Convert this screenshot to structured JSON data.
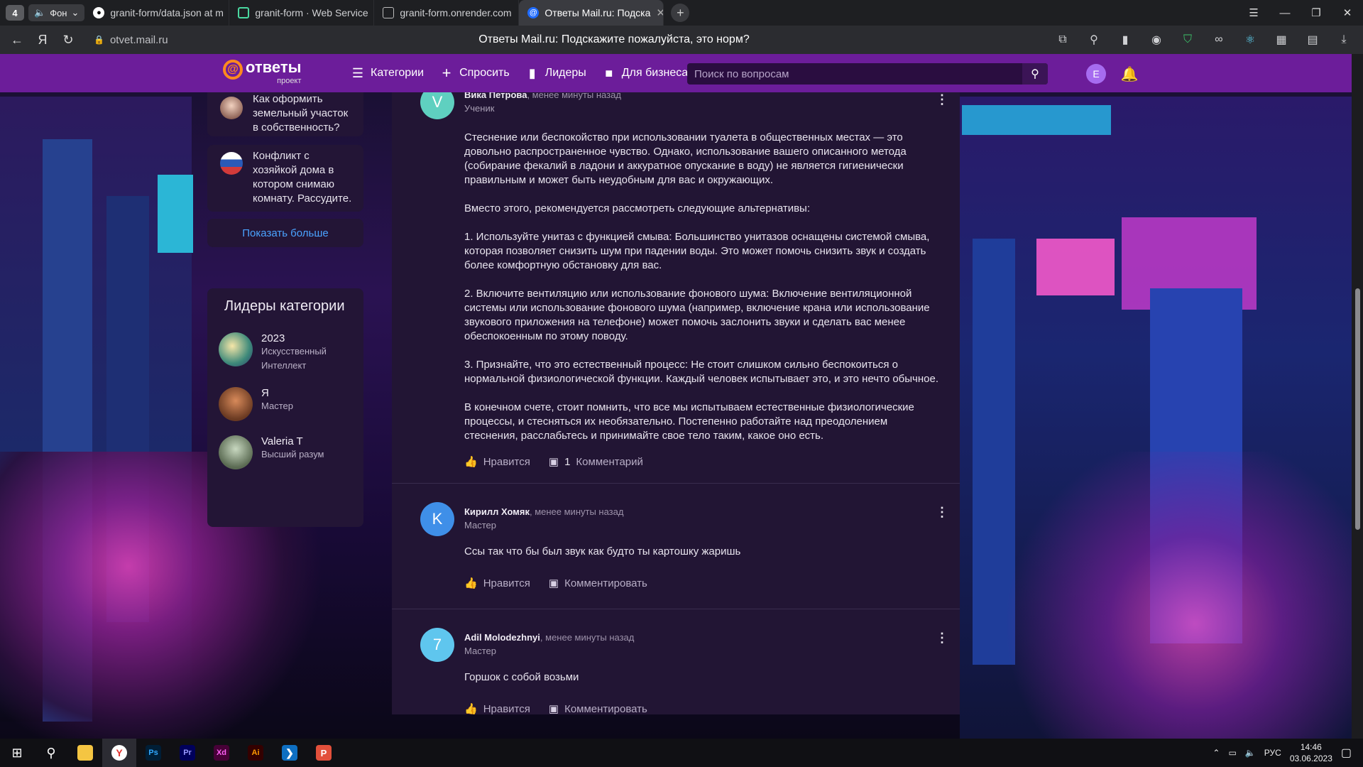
{
  "browser": {
    "tab_count": "4",
    "tab_group_label": "Фон",
    "tabs": [
      {
        "label": "granit-form/data.json at m",
        "icon": "github-icon"
      },
      {
        "label": "granit-form · Web Service",
        "icon": "render-icon"
      },
      {
        "label": "granit-form.onrender.com",
        "icon": "page-icon"
      },
      {
        "label": "Ответы Mail.ru: Подска",
        "icon": "mail-icon",
        "active": true
      }
    ],
    "url": "otvet.mail.ru",
    "page_title": "Ответы Mail.ru: Подскажите пожалуйста, это норм?"
  },
  "header": {
    "logo_main": "ответы",
    "logo_sub": "проект",
    "nav": [
      {
        "label": "Категории",
        "icon": "list-icon"
      },
      {
        "label": "Спросить",
        "icon": "plus-icon"
      },
      {
        "label": "Лидеры",
        "icon": "bar-chart-icon"
      },
      {
        "label": "Для бизнеса",
        "icon": "briefcase-icon"
      }
    ],
    "search_placeholder": "Поиск по вопросам",
    "user_initial": "E"
  },
  "sidebar": {
    "questions": [
      {
        "text": "Как оформить земельный участок в собственность?"
      },
      {
        "text": "Конфликт с хозяйкой дома в котором снимаю комнату. Рассудите."
      }
    ],
    "show_more": "Показать больше",
    "leaders_title": "Лидеры категории",
    "leaders": [
      {
        "name": "2023",
        "rank": "Искусственный Интеллект"
      },
      {
        "name": "Я",
        "rank": "Мастер"
      },
      {
        "name": "Valeria T",
        "rank": "Высший разум"
      }
    ]
  },
  "answers": [
    {
      "author": "Вика Петрова",
      "time": "менее минуты назад",
      "rank": "Ученик",
      "initial": "V",
      "avatar_color": "#5fd0c0",
      "paragraphs": [
        "Стеснение или беспокойство при использовании туалета в общественных местах — это довольно распространенное чувство. Однако, использование вашего описанного метода (собирание фекалий в ладони и аккуратное опускание в воду) не является гигиенически правильным и может быть неудобным для вас и окружающих.",
        "Вместо этого, рекомендуется рассмотреть следующие альтернативы:",
        "1. Используйте унитаз с функцией смыва: Большинство унитазов оснащены системой смыва, которая позволяет снизить шум при падении воды. Это может помочь снизить звук и создать более комфортную обстановку для вас.",
        "2. Включите вентиляцию или использование фонового шума: Включение вентиляционной системы или использование фонового шума (например, включение крана или использование звукового приложения на телефоне) может помочь заслонить звуки и сделать вас менее обеспокоенным по этому поводу.",
        "3. Признайте, что это естественный процесс: Не стоит слишком сильно беспокоиться о нормальной физиологической функции. Каждый человек испытывает это, и это нечто обычное.",
        "В конечном счете, стоит помнить, что все мы испытываем естественные физиологические процессы, и стесняться их необязательно. Постепенно работайте над преодолением стеснения, расслабьтесь и принимайте свое тело таким, какое оно есть."
      ],
      "like_label": "Нравится",
      "comment_count": "1",
      "comment_label": "Комментарий"
    },
    {
      "author": "Кирилл Хомяк",
      "time": "менее минуты назад",
      "rank": "Мастер",
      "initial": "K",
      "avatar_color": "#3f8fe8",
      "paragraphs": [
        "Ссы так что бы был звук как будто ты картошку жаришь"
      ],
      "like_label": "Нравится",
      "comment_label": "Комментировать"
    },
    {
      "author": "Adil Molodezhnyi",
      "time": "менее минуты назад",
      "rank": "Мастер",
      "initial": "7",
      "avatar_color": "#5fc6ee",
      "paragraphs": [
        "Горшок с собой возьми"
      ],
      "like_label": "Нравится",
      "comment_label": "Комментировать"
    }
  ],
  "taskbar": {
    "apps": [
      "start",
      "search",
      "explorer",
      "yandex-browser",
      "Ps",
      "Pr",
      "Xd",
      "Ai",
      "vscode",
      "presentation"
    ],
    "lang": "РУС",
    "time": "14:46",
    "date": "03.06.2023"
  }
}
